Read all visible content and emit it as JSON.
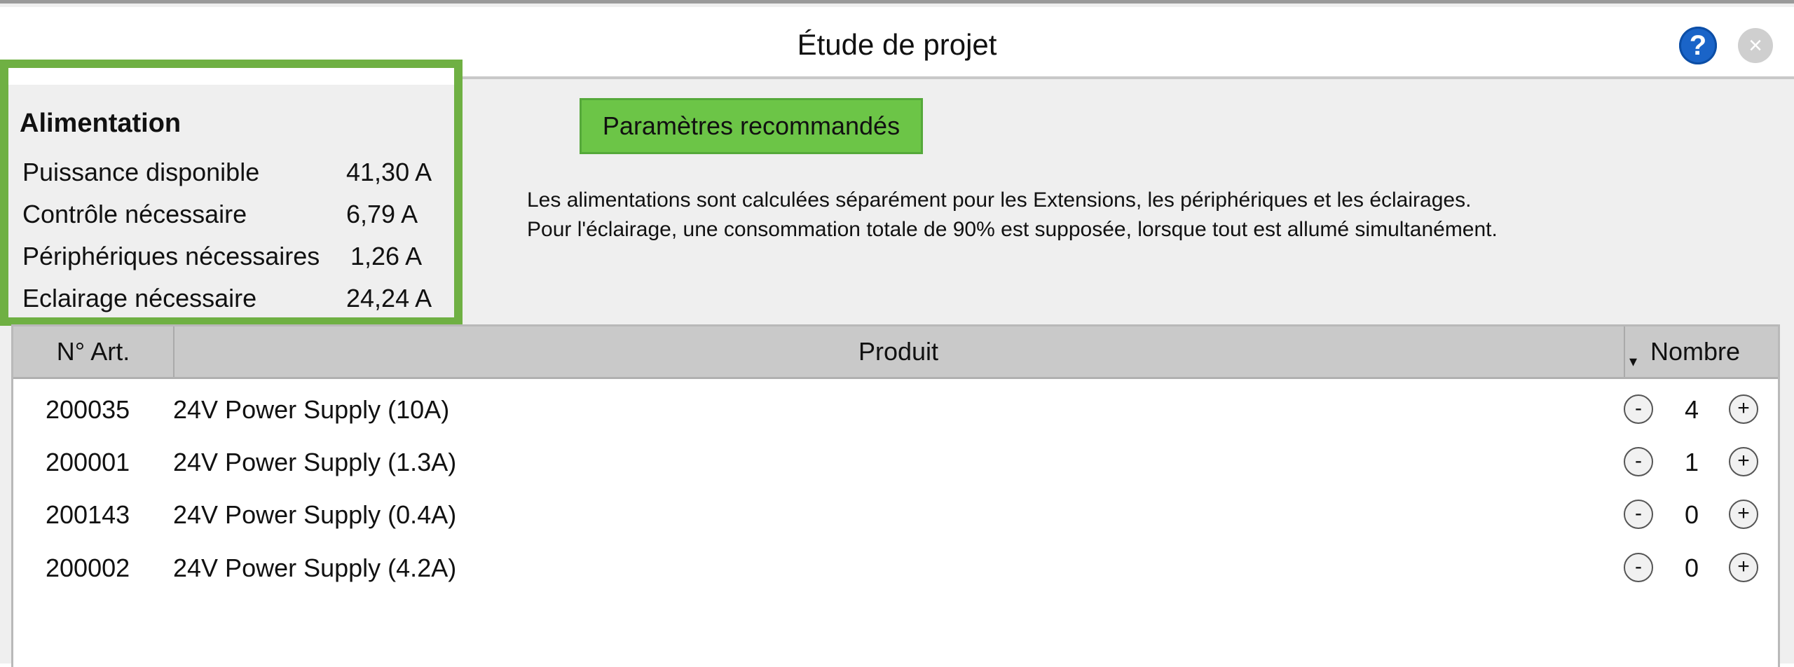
{
  "window": {
    "title": "Étude de projet"
  },
  "titlebar": {
    "help_glyph": "?",
    "close_glyph": "×"
  },
  "power": {
    "heading": "Alimentation",
    "rows": [
      {
        "label": "Puissance disponible",
        "value": "41,30",
        "unit": "A"
      },
      {
        "label": "Contrôle nécessaire",
        "value": "6,79",
        "unit": "A"
      },
      {
        "label": "Périphériques nécessaires",
        "value": "1,26",
        "unit": "A"
      },
      {
        "label": "Eclairage nécessaire",
        "value": "24,24",
        "unit": "A"
      }
    ]
  },
  "recommend_button": {
    "label": "Paramètres recommandés"
  },
  "info": {
    "line1": "Les alimentations sont calculées séparément pour les Extensions, les périphériques et les éclairages.",
    "line2": "Pour l'éclairage, une consommation totale de 90% est supposée, lorsque tout est allumé simultanément."
  },
  "table": {
    "columns": {
      "art": "N° Art.",
      "product": "Produit",
      "count": "Nombre",
      "sort_glyph": "▾"
    },
    "buttons": {
      "minus": "-",
      "plus": "+"
    },
    "rows": [
      {
        "art": "200035",
        "product": "24V Power Supply (10A)",
        "count": "4"
      },
      {
        "art": "200001",
        "product": "24V Power Supply (1.3A)",
        "count": "1"
      },
      {
        "art": "200143",
        "product": "24V Power Supply (0.4A)",
        "count": "0"
      },
      {
        "art": "200002",
        "product": "24V Power Supply (4.2A)",
        "count": "0"
      }
    ]
  },
  "colors": {
    "accent_green": "#6fb043",
    "button_green": "#6cc547",
    "help_blue": "#1a64c8"
  }
}
